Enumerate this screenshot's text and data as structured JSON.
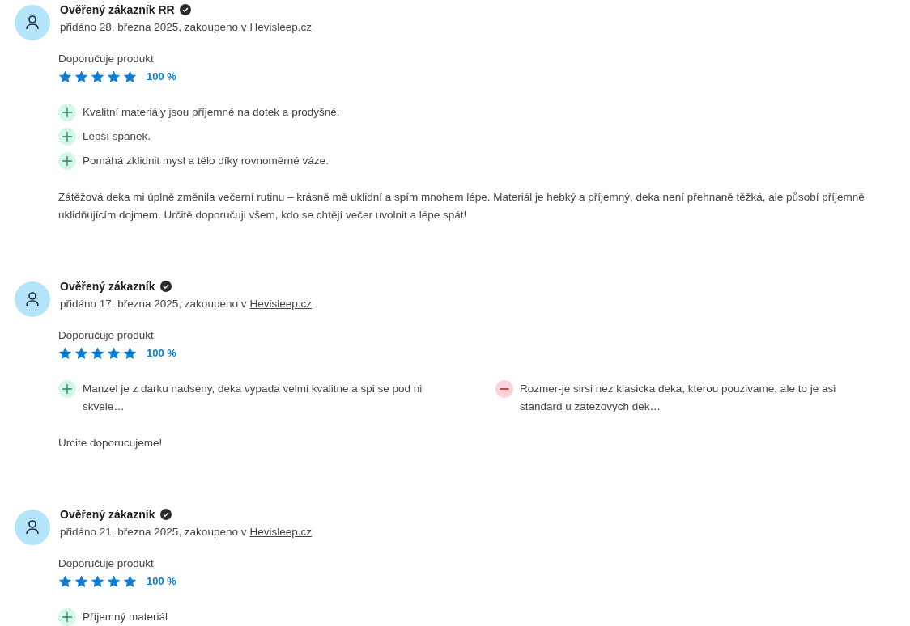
{
  "reviews": [
    {
      "author": "Ověřený zákazník RR",
      "meta": "přidáno 28. března 2025, zakoupeno v",
      "shop": "Hevisleep.cz",
      "recommendation": "Doporučuje produkt",
      "stars": 5,
      "percent": "100 %",
      "pros": [
        "Kvalitní materiály jsou příjemné na dotek a prodyšné.",
        "Lepší spánek.",
        "Pomáhá zklidnit mysl a tělo díky rovnoměrné váze."
      ],
      "text": "Zátěžová deka mi úplně změnila večerní rutinu – krásně mě uklidní a spím mnohem lépe. Materiál je hebký a příjemný, deka není přehnaně těžká, ale působí příjemně uklidňujícím dojmem. Určitě doporučuji všem, kdo se chtějí večer uvolnit a lépe spát!"
    },
    {
      "author": "Ověřený zákazník",
      "meta": "přidáno 17. března 2025, zakoupeno v",
      "shop": "Hevisleep.cz",
      "recommendation": "Doporučuje produkt",
      "stars": 5,
      "percent": "100 %",
      "pros": [
        "Manzel je z darku nadseny, deka vypada velmi kvalitne a spi se pod ni skvele…"
      ],
      "cons": [
        "Rozmer-je sirsi nez klasicka deka, kterou pouzivame, ale to je asi standard u zatezovych dek…"
      ],
      "text": "Urcite doporucujeme!"
    },
    {
      "author": "Ověřený zákazník",
      "meta": "přidáno 21. března 2025, zakoupeno v",
      "shop": "Hevisleep.cz",
      "recommendation": "Doporučuje produkt",
      "stars": 5,
      "percent": "100 %",
      "pros": [
        "Příjemný materiál"
      ]
    }
  ]
}
